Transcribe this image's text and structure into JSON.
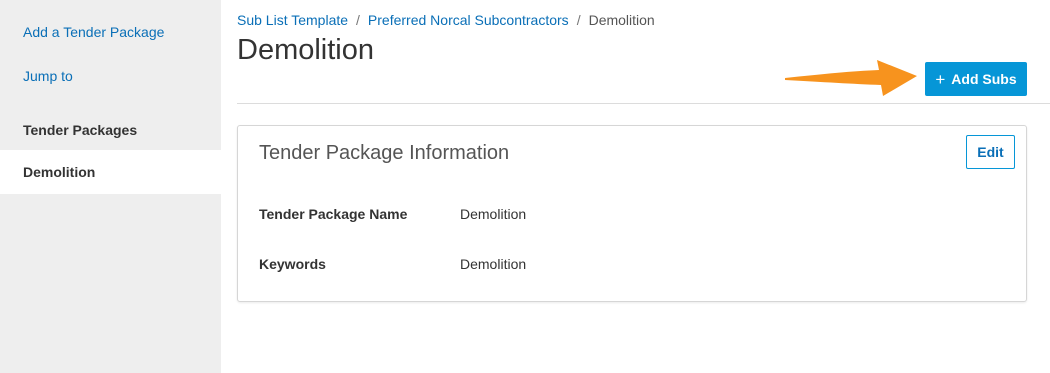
{
  "sidebar": {
    "links": [
      "Add a Tender Package",
      "Jump to"
    ],
    "section_heading": "Tender Packages",
    "active_item": "Demolition"
  },
  "breadcrumb": {
    "items": [
      "Sub List Template",
      "Preferred Norcal Subcontractors"
    ],
    "current": "Demolition",
    "separator": "/"
  },
  "page": {
    "title": "Demolition",
    "add_button": {
      "icon": "+",
      "label": "Add Subs"
    }
  },
  "annotation": {
    "arrow_color": "#f7931e"
  },
  "card": {
    "title": "Tender Package Information",
    "edit_label": "Edit",
    "fields": [
      {
        "label": "Tender Package Name",
        "value": "Demolition"
      },
      {
        "label": "Keywords",
        "value": "Demolition"
      }
    ]
  },
  "colors": {
    "accent": "#0696d7",
    "link": "#0a6fb7",
    "sidebar_bg": "#eeeeee"
  }
}
